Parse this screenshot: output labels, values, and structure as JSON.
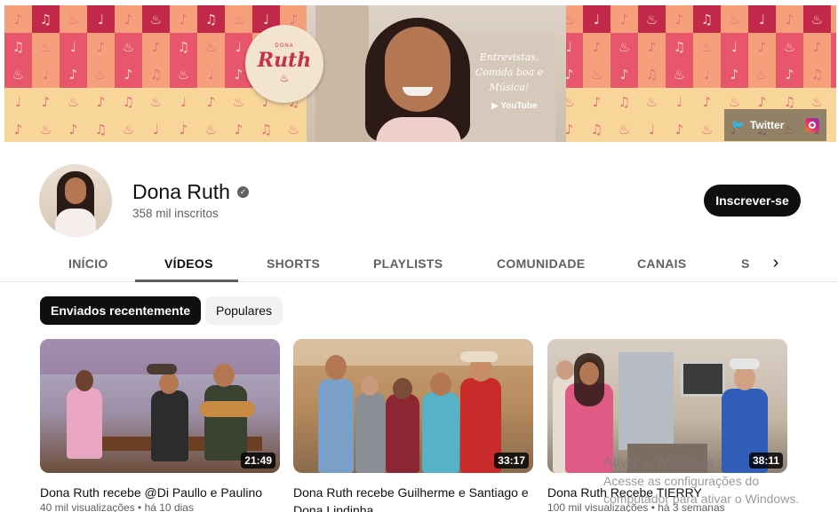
{
  "banner": {
    "logo_small": "DONA",
    "logo_name": "Ruth",
    "tagline": "Entrevistas, Comida boa e Música!",
    "platform": "YouTube",
    "social": {
      "twitter_label": "Twitter",
      "twitter_icon": "twitter-bird-icon",
      "instagram_icon": "instagram-icon"
    },
    "colors": {
      "pink": "#e8566c",
      "crimson": "#c2284a",
      "peach": "#f5a07a",
      "cream": "#f8d69a"
    }
  },
  "channel": {
    "name": "Dona Ruth",
    "verified_icon": "verified-check-icon",
    "subscribers": "358 mil inscritos",
    "subscribe_label": "Inscrever-se"
  },
  "tabs": [
    {
      "label": "INÍCIO",
      "active": false
    },
    {
      "label": "VÍDEOS",
      "active": true
    },
    {
      "label": "SHORTS",
      "active": false
    },
    {
      "label": "PLAYLISTS",
      "active": false
    },
    {
      "label": "COMUNIDADE",
      "active": false
    },
    {
      "label": "CANAIS",
      "active": false
    },
    {
      "label": "S",
      "active": false
    }
  ],
  "filters": [
    {
      "label": "Enviados recentemente",
      "active": true
    },
    {
      "label": "Populares",
      "active": false
    }
  ],
  "videos": [
    {
      "title": "Dona Ruth recebe @Di Paullo e Paulino",
      "duration": "21:49",
      "meta": "40 mil visualizações • há 10 dias"
    },
    {
      "title": "Dona Ruth recebe Guilherme e Santiago e Dona Lindinha",
      "duration": "33:17",
      "meta": ""
    },
    {
      "title": "Dona Ruth Recebe TIERRY",
      "duration": "38:11",
      "meta": "100 mil visualizações • há 3 semanas"
    }
  ],
  "watermark": {
    "line1": "Ativar o Windows",
    "line2": "Acesse as configurações do",
    "line3": "computador para ativar o Windows."
  }
}
